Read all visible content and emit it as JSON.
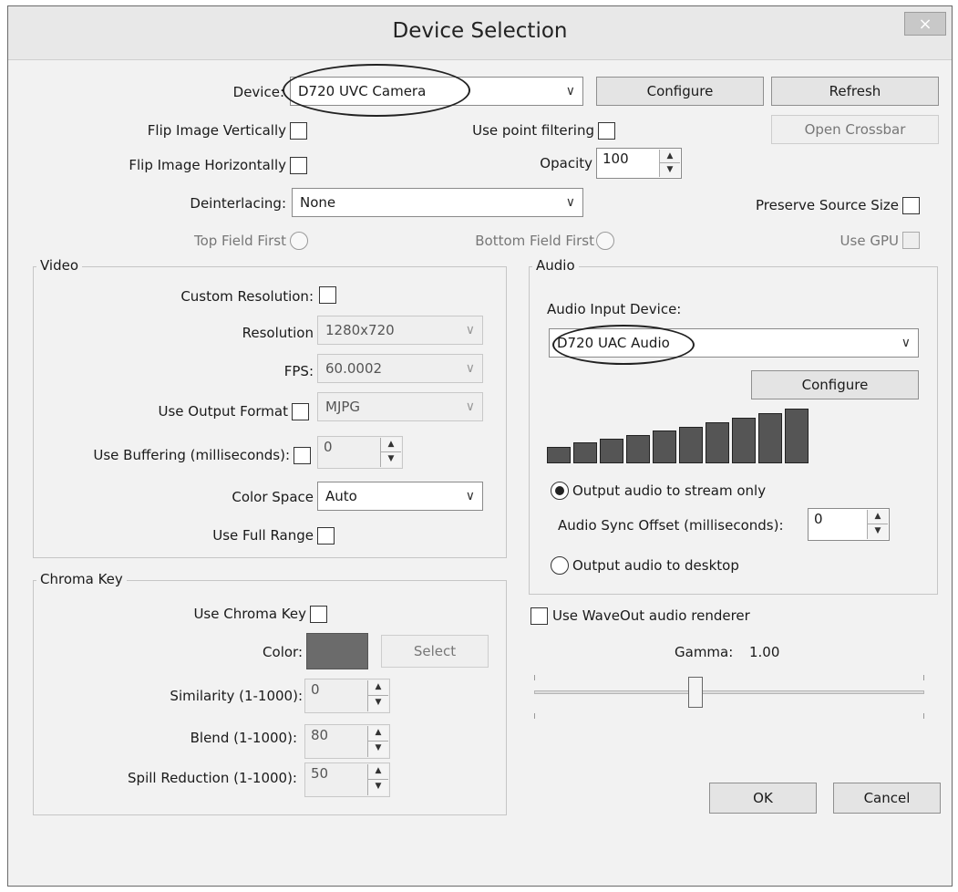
{
  "window": {
    "title": "Device Selection",
    "close_label": "×"
  },
  "top": {
    "device_label": "Device:",
    "device_value": "D720 UVC Camera",
    "configure": "Configure",
    "refresh": "Refresh",
    "open_crossbar": "Open Crossbar",
    "flip_v": "Flip Image Vertically",
    "flip_h": "Flip Image Horizontally",
    "point_filter": "Use point filtering",
    "opacity_label": "Opacity",
    "opacity_value": "100",
    "deinterlace_label": "Deinterlacing:",
    "deinterlace_value": "None",
    "preserve": "Preserve Source Size",
    "top_field": "Top Field First",
    "bottom_field": "Bottom Field First",
    "use_gpu": "Use GPU"
  },
  "video": {
    "title": "Video",
    "custom_res": "Custom Resolution:",
    "res_label": "Resolution",
    "res_value": "1280x720",
    "fps_label": "FPS:",
    "fps_value": "60.0002",
    "out_fmt": "Use Output Format",
    "out_fmt_value": "MJPG",
    "buffering": "Use Buffering (milliseconds):",
    "buffering_value": "0",
    "color_space_label": "Color Space",
    "color_space_value": "Auto",
    "full_range": "Use Full Range"
  },
  "audio": {
    "title": "Audio",
    "input_label": "Audio Input Device:",
    "input_value": "D720 UAC Audio",
    "configure": "Configure",
    "meter_levels": [
      0.2,
      0.28,
      0.36,
      0.44,
      0.53,
      0.62,
      0.71,
      0.8,
      0.9,
      1.0
    ],
    "stream_only": "Output audio to stream only",
    "sync_label": "Audio Sync Offset (milliseconds):",
    "sync_value": "0",
    "desktop": "Output audio to desktop"
  },
  "chroma": {
    "title": "Chroma Key",
    "use": "Use Chroma Key",
    "color_label": "Color:",
    "color": "#6b6b6b",
    "select": "Select",
    "similarity_label": "Similarity (1-1000):",
    "similarity_value": "0",
    "blend_label": "Blend (1-1000):",
    "blend_value": "80",
    "spill_label": "Spill Reduction (1-1000):",
    "spill_value": "50"
  },
  "misc": {
    "waveout": "Use WaveOut audio renderer",
    "gamma_label": "Gamma:",
    "gamma_value": "1.00",
    "gamma_fraction": 0.41,
    "ok": "OK",
    "cancel": "Cancel"
  }
}
